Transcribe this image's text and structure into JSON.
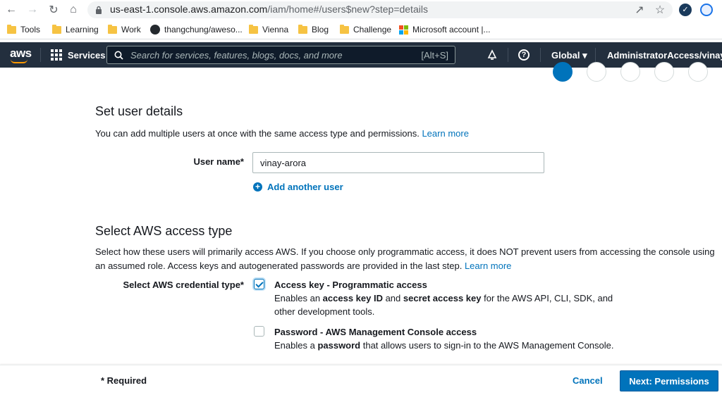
{
  "browser": {
    "url_host": "us-east-1.console.aws.amazon.com",
    "url_path": "/iam/home#/users$new?step=details",
    "bookmarks": [
      {
        "label": "Tools",
        "icon": "folder-icon"
      },
      {
        "label": "Learning",
        "icon": "folder-icon"
      },
      {
        "label": "Work",
        "icon": "folder-icon"
      },
      {
        "label": "thangchung/aweso...",
        "icon": "github-icon"
      },
      {
        "label": "Vienna",
        "icon": "folder-icon"
      },
      {
        "label": "Blog",
        "icon": "folder-icon"
      },
      {
        "label": "Challenge",
        "icon": "folder-icon"
      },
      {
        "label": "Microsoft account |...",
        "icon": "microsoft-icon"
      }
    ]
  },
  "aws_header": {
    "logo": "aws",
    "services": "Services",
    "search_placeholder": "Search for services, features, blogs, docs, and more",
    "search_shortcut": "[Alt+S]",
    "region": "Global",
    "account": "AdministratorAccess/vinay.arora"
  },
  "user_details": {
    "title": "Set user details",
    "description": "You can add multiple users at once with the same access type and permissions.",
    "learn_more": "Learn more",
    "user_name_label": "User name*",
    "user_name_value": "vinay-arora",
    "add_another_user": "Add another user"
  },
  "access_type": {
    "title": "Select AWS access type",
    "description": "Select how these users will primarily access AWS. If you choose only programmatic access, it does NOT prevent users from accessing the console using an assumed role. Access keys and autogenerated passwords are provided in the last step.",
    "learn_more": "Learn more",
    "credential_label": "Select AWS credential type*",
    "options": [
      {
        "title": "Access key - Programmatic access",
        "desc_parts": [
          "Enables an ",
          "access key ID",
          " and ",
          "secret access key",
          " for the AWS API, CLI, SDK, and other development tools."
        ],
        "checked": true
      },
      {
        "title": "Password - AWS Management Console access",
        "desc_parts": [
          "Enables a ",
          "password",
          " that allows users to sign-in to the AWS Management Console."
        ],
        "checked": false
      }
    ]
  },
  "footer": {
    "required": "* Required",
    "cancel": "Cancel",
    "next": "Next: Permissions"
  },
  "colors": {
    "aws_nav": "#232f3e",
    "link": "#0073bb",
    "primary_button": "#0073bb"
  }
}
